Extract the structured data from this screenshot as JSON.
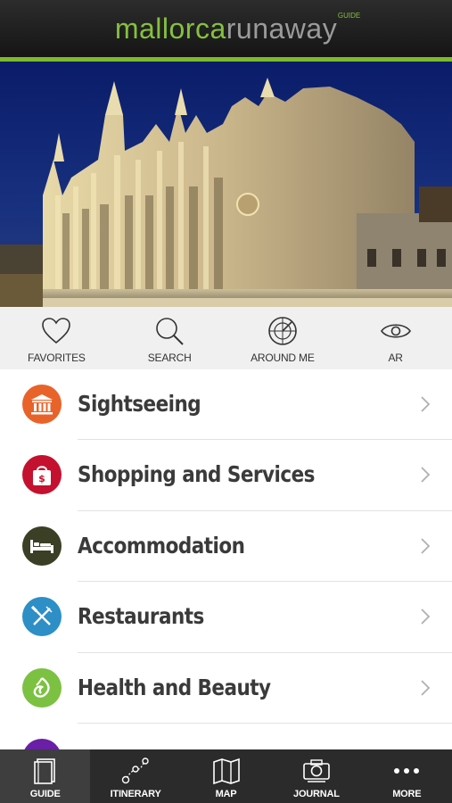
{
  "header": {
    "logo_part1": "mallorca",
    "logo_part2": "runaway",
    "logo_tag": "GUIDE"
  },
  "quick_actions": [
    {
      "label": "FAVORITES",
      "icon": "heart-icon"
    },
    {
      "label": "SEARCH",
      "icon": "search-icon"
    },
    {
      "label": "AROUND ME",
      "icon": "radar-icon"
    },
    {
      "label": "AR",
      "icon": "eye-icon"
    }
  ],
  "categories": [
    {
      "label": "Sightseeing",
      "icon": "museum-icon",
      "color": "#e8632a"
    },
    {
      "label": "Shopping and Services",
      "icon": "shopping-bag-icon",
      "color": "#c4112f"
    },
    {
      "label": "Accommodation",
      "icon": "bed-icon",
      "color": "#3b3f25"
    },
    {
      "label": "Restaurants",
      "icon": "cutlery-icon",
      "color": "#2d8fc6"
    },
    {
      "label": "Health and Beauty",
      "icon": "leaf-icon",
      "color": "#7cc142"
    },
    {
      "label": "",
      "icon": "category-icon",
      "color": "#6a1fa6"
    }
  ],
  "tabbar": [
    {
      "label": "GUIDE",
      "icon": "book-icon",
      "active": true
    },
    {
      "label": "ITINERARY",
      "icon": "route-icon",
      "active": false
    },
    {
      "label": "MAP",
      "icon": "map-icon",
      "active": false
    },
    {
      "label": "JOURNAL",
      "icon": "camera-icon",
      "active": false
    },
    {
      "label": "MORE",
      "icon": "more-icon",
      "active": false
    }
  ],
  "colors": {
    "accent_green": "#7dbb2a",
    "logo_grey": "#9b9b9b",
    "text_dark": "#3a3a3a",
    "tabbar_bg": "#2b2b2b"
  }
}
